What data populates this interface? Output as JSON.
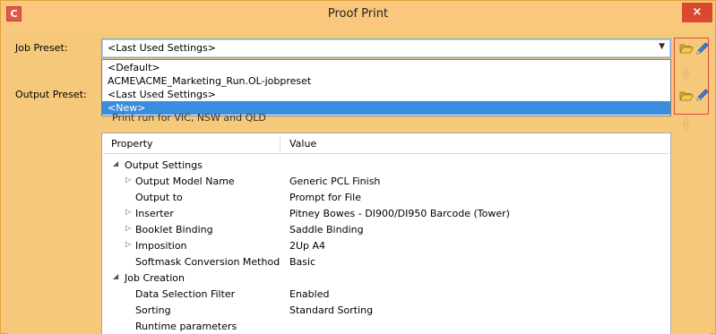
{
  "window": {
    "app_icon": "C",
    "title": "Proof Print",
    "close": "×"
  },
  "labels": {
    "job_preset": "Job Preset:",
    "output_preset": "Output Preset:"
  },
  "job_preset": {
    "value": "<Last Used Settings>",
    "options": [
      "<Default>",
      "ACME\\ACME_Marketing_Run.OL-jobpreset",
      "<Last Used Settings>",
      "<New>"
    ],
    "selected_option": "<New>"
  },
  "description": "Print run for VIC, NSW and QLD",
  "table": {
    "headers": {
      "property": "Property",
      "value": "Value"
    },
    "groups": {
      "output_settings": "Output Settings",
      "job_creation": "Job Creation"
    },
    "rows": [
      {
        "property": "Output Model Name",
        "value": "Generic PCL Finish"
      },
      {
        "property": "Output to",
        "value": "Prompt for File"
      },
      {
        "property": "Inserter",
        "value": "Pitney Bowes - DI900/DI950 Barcode (Tower)"
      },
      {
        "property": "Booklet Binding",
        "value": "Saddle Binding"
      },
      {
        "property": "Imposition",
        "value": "2Up A4"
      },
      {
        "property": "Softmask Conversion Method",
        "value": "Basic"
      },
      {
        "property": "Data Selection Filter",
        "value": "Enabled"
      },
      {
        "property": "Sorting",
        "value": "Standard Sorting"
      },
      {
        "property": "Runtime parameters",
        "value": ""
      }
    ]
  },
  "icons": {
    "folder": "folder-open-icon",
    "pencil": "pencil-edit-icon",
    "expand": "expand-arrow-icon",
    "collapse": "collapse-arrow-icon"
  },
  "colors": {
    "titlebar": "#fac77c",
    "selection": "#3a8dde",
    "close": "#d9482f",
    "highlight_box": "#e04545"
  }
}
